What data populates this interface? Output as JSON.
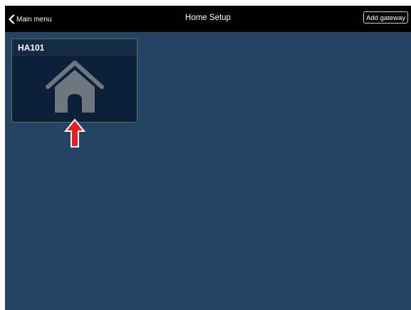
{
  "header": {
    "back_label": "Main menu",
    "title": "Home Setup",
    "add_gateway_label": "Add gateway"
  },
  "gateways": [
    {
      "name": "HA101",
      "icon": "house-icon"
    }
  ],
  "colors": {
    "background": "#254464",
    "topbar": "#000000",
    "tile": "#0b2038",
    "tile_border": "#4c7562",
    "icon": "#6e7680",
    "arrow": "#e8201c"
  }
}
